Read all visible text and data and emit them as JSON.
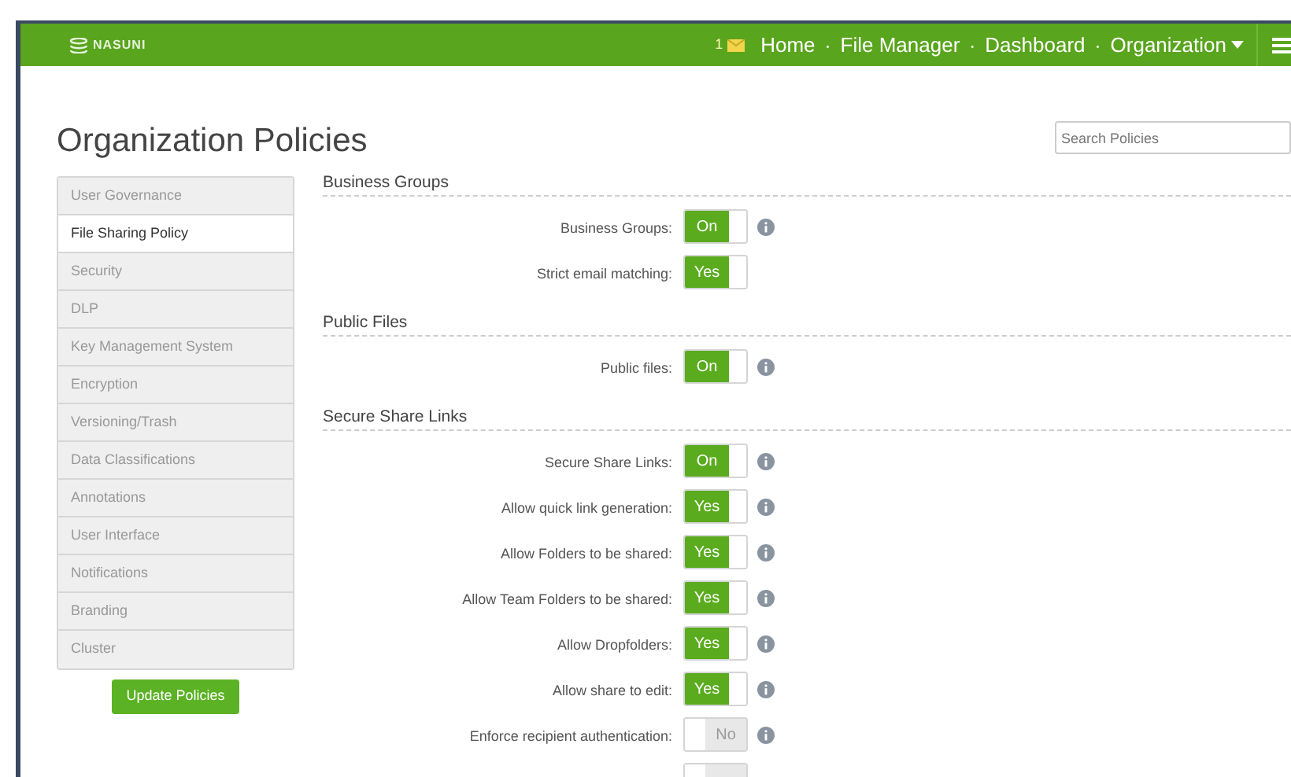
{
  "navbar": {
    "logo": "NASUNI",
    "message_count": "1",
    "links": [
      {
        "label": "Home",
        "dropdown": false
      },
      {
        "label": "File Manager",
        "dropdown": false
      },
      {
        "label": "Dashboard",
        "dropdown": false
      },
      {
        "label": "Organization",
        "dropdown": true
      }
    ],
    "separator": "·"
  },
  "page": {
    "title": "Organization Policies",
    "search": {
      "placeholder": "Search Policies"
    }
  },
  "sidebar": {
    "items": [
      {
        "label": "User Governance",
        "selected": false
      },
      {
        "label": "File Sharing Policy",
        "selected": true
      },
      {
        "label": "Security",
        "selected": false
      },
      {
        "label": "DLP",
        "selected": false
      },
      {
        "label": "Key Management System",
        "selected": false
      },
      {
        "label": "Encryption",
        "selected": false
      },
      {
        "label": "Versioning/Trash",
        "selected": false
      },
      {
        "label": "Data Classifications",
        "selected": false
      },
      {
        "label": "Annotations",
        "selected": false
      },
      {
        "label": "User Interface",
        "selected": false
      },
      {
        "label": "Notifications",
        "selected": false
      },
      {
        "label": "Branding",
        "selected": false
      },
      {
        "label": "Cluster",
        "selected": false
      }
    ],
    "button": "Update Policies"
  },
  "sections": [
    {
      "title": "Business Groups",
      "settings": [
        {
          "label": "Business Groups:",
          "on": true,
          "value": "On",
          "info": true
        },
        {
          "label": "Strict email matching:",
          "on": true,
          "value": "Yes",
          "info": false
        }
      ]
    },
    {
      "title": "Public Files",
      "settings": [
        {
          "label": "Public files:",
          "on": true,
          "value": "On",
          "info": true
        }
      ]
    },
    {
      "title": "Secure Share Links",
      "settings": [
        {
          "label": "Secure Share Links:",
          "on": true,
          "value": "On",
          "info": true
        },
        {
          "label": "Allow quick link generation:",
          "on": true,
          "value": "Yes",
          "info": true
        },
        {
          "label": "Allow Folders to be shared:",
          "on": true,
          "value": "Yes",
          "info": true
        },
        {
          "label": "Allow Team Folders to be shared:",
          "on": true,
          "value": "Yes",
          "info": true
        },
        {
          "label": "Allow Dropfolders:",
          "on": true,
          "value": "Yes",
          "info": true
        },
        {
          "label": "Allow share to edit:",
          "on": true,
          "value": "Yes",
          "info": true
        },
        {
          "label": "Enforce recipient authentication:",
          "on": false,
          "value": "No",
          "info": true
        },
        {
          "on": false,
          "info": false
        }
      ]
    }
  ]
}
